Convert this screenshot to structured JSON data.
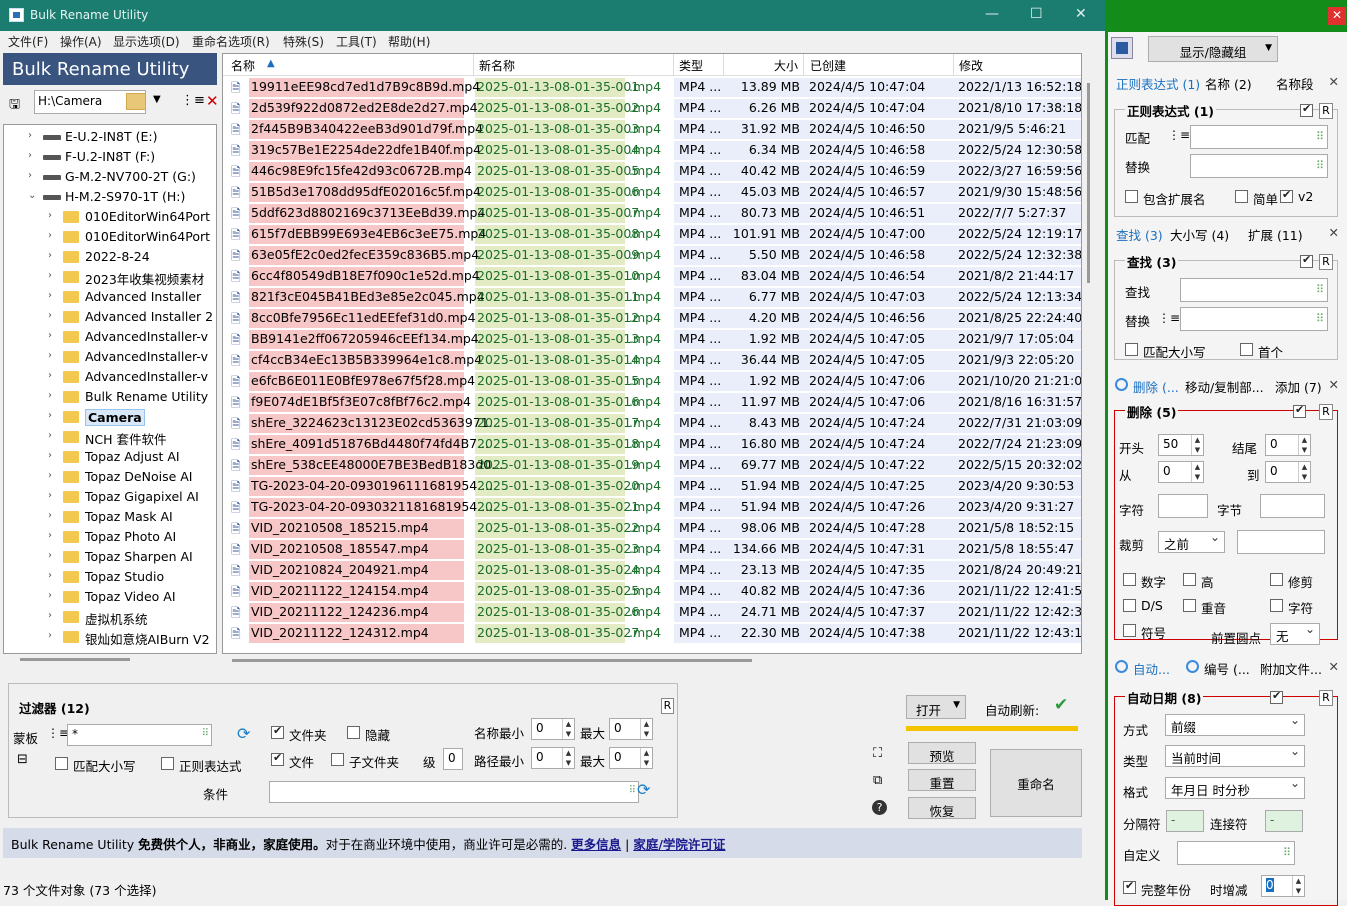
{
  "window": {
    "title": "Bulk Rename Utility"
  },
  "menu": [
    "文件(F)",
    "操作(A)",
    "显示选项(D)",
    "重命名选项(R)",
    "特殊(S)",
    "工具(T)",
    "帮助(H)"
  ],
  "brand": "Bulk Rename Utility",
  "path": "H:\\Camera",
  "tree": [
    {
      "label": "E-U.2-IN8T (E:)",
      "type": "drive",
      "level": 0
    },
    {
      "label": "F-U.2-IN8T (F:)",
      "type": "drive",
      "level": 0
    },
    {
      "label": "G-M.2-NV700-2T (G:)",
      "type": "drive",
      "level": 0
    },
    {
      "label": "H-M.2-S970-1T (H:)",
      "type": "drive",
      "level": 0,
      "open": true
    },
    {
      "label": "010EditorWin64Port",
      "type": "folder",
      "level": 1
    },
    {
      "label": "010EditorWin64Port",
      "type": "folder",
      "level": 1
    },
    {
      "label": "2022-8-24",
      "type": "folder",
      "level": 1
    },
    {
      "label": "2023年收集视频素材",
      "type": "folder",
      "level": 1
    },
    {
      "label": "Advanced Installer",
      "type": "folder",
      "level": 1
    },
    {
      "label": "Advanced Installer 2",
      "type": "folder",
      "level": 1
    },
    {
      "label": "AdvancedInstaller-v",
      "type": "folder",
      "level": 1
    },
    {
      "label": "AdvancedInstaller-v",
      "type": "folder",
      "level": 1
    },
    {
      "label": "AdvancedInstaller-v",
      "type": "folder",
      "level": 1
    },
    {
      "label": "Bulk Rename Utility",
      "type": "folder",
      "level": 1
    },
    {
      "label": "Camera",
      "type": "folder",
      "level": 1,
      "selected": true
    },
    {
      "label": "NCH 套件软件",
      "type": "folder",
      "level": 1
    },
    {
      "label": "Topaz Adjust AI",
      "type": "folder",
      "level": 1
    },
    {
      "label": "Topaz DeNoise AI",
      "type": "folder",
      "level": 1
    },
    {
      "label": "Topaz Gigapixel AI",
      "type": "folder",
      "level": 1
    },
    {
      "label": "Topaz Mask AI",
      "type": "folder",
      "level": 1
    },
    {
      "label": "Topaz Photo AI",
      "type": "folder",
      "level": 1
    },
    {
      "label": "Topaz Sharpen AI",
      "type": "folder",
      "level": 1
    },
    {
      "label": "Topaz Studio",
      "type": "folder",
      "level": 1
    },
    {
      "label": "Topaz Video AI",
      "type": "folder",
      "level": 1
    },
    {
      "label": "虚拟机系统",
      "type": "folder",
      "level": 1
    },
    {
      "label": "银灿如意烧AIBurn V2",
      "type": "folder",
      "level": 1
    }
  ],
  "columns": [
    "名称",
    "新名称",
    "类型",
    "大小",
    "已创建",
    "修改"
  ],
  "files": [
    [
      "19911eEE98cd7ed1d7B9c8B9d.mp4",
      "2025-01-13-08-01-35-001",
      ".mp4",
      "MP4 ...",
      "13.89 MB",
      "2024/4/5 10:47:04",
      "2022/1/13 16:52:18"
    ],
    [
      "2d539f922d0872ed2E8de2d27.mp4",
      "2025-01-13-08-01-35-002",
      ".mp4",
      "MP4 ...",
      "6.26 MB",
      "2024/4/5 10:47:04",
      "2021/8/10 17:38:18"
    ],
    [
      "2f445B9B340422eeB3d901d79f.mp4",
      "2025-01-13-08-01-35-003",
      ".mp4",
      "MP4 ...",
      "31.92 MB",
      "2024/4/5 10:46:50",
      "2021/9/5 5:46:21"
    ],
    [
      "319c57Be1E2254de22dfe1B40f.mp4",
      "2025-01-13-08-01-35-004",
      ".mp4",
      "MP4 ...",
      "6.34 MB",
      "2024/4/5 10:46:58",
      "2022/5/24 12:30:58"
    ],
    [
      "446c98E9fc15fe42d93c0672B.mp4",
      "2025-01-13-08-01-35-005",
      ".mp4",
      "MP4 ...",
      "40.42 MB",
      "2024/4/5 10:46:59",
      "2022/3/27 16:59:56"
    ],
    [
      "51B5d3e1708dd95dfE02016c5f.mp4",
      "2025-01-13-08-01-35-006",
      ".mp4",
      "MP4 ...",
      "45.03 MB",
      "2024/4/5 10:46:57",
      "2021/9/30 15:48:56"
    ],
    [
      "5ddf623d8802169c3713EeBd39.mp4",
      "2025-01-13-08-01-35-007",
      ".mp4",
      "MP4 ...",
      "80.73 MB",
      "2024/4/5 10:46:51",
      "2022/7/7 5:27:37"
    ],
    [
      "615f7dEBB99E693e4EB6c3eE75.mp4",
      "2025-01-13-08-01-35-008",
      ".mp4",
      "MP4 ...",
      "101.91 MB",
      "2024/4/5 10:47:00",
      "2022/5/24 12:19:17"
    ],
    [
      "63e05fE2c0ed2fecE359c836B5.mp4",
      "2025-01-13-08-01-35-009",
      ".mp4",
      "MP4 ...",
      "5.50 MB",
      "2024/4/5 10:46:58",
      "2022/5/24 12:32:38"
    ],
    [
      "6cc4f80549dB18E7f090c1e52d.mp4",
      "2025-01-13-08-01-35-010",
      ".mp4",
      "MP4 ...",
      "83.04 MB",
      "2024/4/5 10:46:54",
      "2021/8/2 21:44:17"
    ],
    [
      "821f3cE045B41BEd3e85e2c045.mp4",
      "2025-01-13-08-01-35-011",
      ".mp4",
      "MP4 ...",
      "6.77 MB",
      "2024/4/5 10:47:03",
      "2022/5/24 12:13:34"
    ],
    [
      "8cc0Bfe7956Ec11edEEfef31d0.mp4",
      "2025-01-13-08-01-35-012",
      ".mp4",
      "MP4 ...",
      "4.20 MB",
      "2024/4/5 10:46:56",
      "2021/8/25 22:24:40"
    ],
    [
      "BB9141e2ff067205946cEEf134.mp4",
      "2025-01-13-08-01-35-013",
      ".mp4",
      "MP4 ...",
      "1.92 MB",
      "2024/4/5 10:47:05",
      "2021/9/7 17:05:04"
    ],
    [
      "cf4ccB34eEc13B5B339964e1c8.mp4",
      "2025-01-13-08-01-35-014",
      ".mp4",
      "MP4 ...",
      "36.44 MB",
      "2024/4/5 10:47:05",
      "2021/9/3 22:05:20"
    ],
    [
      "e6fcB6E011E0BfE978e67f5f28.mp4",
      "2025-01-13-08-01-35-015",
      ".mp4",
      "MP4 ...",
      "1.92 MB",
      "2024/4/5 10:47:06",
      "2021/10/20 21:21:04"
    ],
    [
      "f9E074dE1Bf5f3E07c8fBf76c2.mp4",
      "2025-01-13-08-01-35-016",
      ".mp4",
      "MP4 ...",
      "11.97 MB",
      "2024/4/5 10:47:06",
      "2021/8/16 16:31:57"
    ],
    [
      "shEre_3224623c13123E02cd5363971...",
      "2025-01-13-08-01-35-017",
      ".mp4",
      "MP4 ...",
      "8.43 MB",
      "2024/4/5 10:47:24",
      "2022/7/31 21:03:09"
    ],
    [
      "shEre_4091d51876Bd4480f74fd4B7...",
      "2025-01-13-08-01-35-018",
      ".mp4",
      "MP4 ...",
      "16.80 MB",
      "2024/4/5 10:47:24",
      "2022/7/24 21:23:09"
    ],
    [
      "shEre_538cEE48000E7BE3BedB183d0...",
      "2025-01-13-08-01-35-019",
      ".mp4",
      "MP4 ...",
      "69.77 MB",
      "2024/4/5 10:47:22",
      "2022/5/15 20:32:02"
    ],
    [
      "TG-2023-04-20-0930196111681954....",
      "2025-01-13-08-01-35-020",
      ".mp4",
      "MP4 ...",
      "51.94 MB",
      "2024/4/5 10:47:25",
      "2023/4/20 9:30:53"
    ],
    [
      "TG-2023-04-20-0930321181681954....",
      "2025-01-13-08-01-35-021",
      ".mp4",
      "MP4 ...",
      "51.94 MB",
      "2024/4/5 10:47:26",
      "2023/4/20 9:31:27"
    ],
    [
      "VID_20210508_185215.mp4",
      "2025-01-13-08-01-35-022",
      ".mp4",
      "MP4 ...",
      "98.06 MB",
      "2024/4/5 10:47:28",
      "2021/5/8 18:52:15"
    ],
    [
      "VID_20210508_185547.mp4",
      "2025-01-13-08-01-35-023",
      ".mp4",
      "MP4 ...",
      "134.66 MB",
      "2024/4/5 10:47:31",
      "2021/5/8 18:55:47"
    ],
    [
      "VID_20210824_204921.mp4",
      "2025-01-13-08-01-35-024",
      ".mp4",
      "MP4 ...",
      "23.13 MB",
      "2024/4/5 10:47:35",
      "2021/8/24 20:49:21"
    ],
    [
      "VID_20211122_124154.mp4",
      "2025-01-13-08-01-35-025",
      ".mp4",
      "MP4 ...",
      "40.82 MB",
      "2024/4/5 10:47:36",
      "2021/11/22 12:41:54"
    ],
    [
      "VID_20211122_124236.mp4",
      "2025-01-13-08-01-35-026",
      ".mp4",
      "MP4 ...",
      "24.71 MB",
      "2024/4/5 10:47:37",
      "2021/11/22 12:42:36"
    ],
    [
      "VID_20211122_124312.mp4",
      "2025-01-13-08-01-35-027",
      ".mp4",
      "MP4 ...",
      "22.30 MB",
      "2024/4/5 10:47:38",
      "2021/11/22 12:43:12"
    ]
  ],
  "filter": {
    "title": "过滤器 (12)",
    "mask_label": "蒙板",
    "mask_value": "*",
    "match_case": "匹配大小写",
    "regex": "正则表达式",
    "folders": "文件夹",
    "hidden": "隐藏",
    "files": "文件",
    "subfolders": "子文件夹",
    "level_label": "级",
    "level": "0",
    "name_min": "名称最小",
    "name_min_v": "0",
    "max1": "最大",
    "max1_v": "0",
    "path_min": "路径最小",
    "path_min_v": "0",
    "max2": "最大",
    "max2_v": "0",
    "cond": "条件",
    "r": "R"
  },
  "actions": {
    "open": "打开",
    "autorefresh": "自动刷新:",
    "preview": "预览",
    "reset": "重置",
    "restore": "恢复",
    "rename": "重命名"
  },
  "info": {
    "text1": "Bulk Rename Utility ",
    "bold": "免费供个人，非商业，家庭使用。",
    "text2": "对于在商业环境中使用，商业许可是必需的.",
    "link1": "更多信息",
    "sep": "|",
    "link2": "家庭/学院许可证"
  },
  "status": "73 个文件对象  (73 个选择)",
  "right": {
    "group_btn": "显示/隐藏组",
    "tabs1": [
      "正则表达式 (1)",
      "名称 (2)",
      "名称段"
    ],
    "regex": {
      "title": "正则表达式 (1)",
      "match": "匹配",
      "replace": "替换",
      "incl_ext": "包含扩展名",
      "simple": "简单",
      "v2": "v2",
      "r": "R"
    },
    "tabs2": [
      "查找 (3)",
      "大小写 (4)",
      "扩展 (11)"
    ],
    "find": {
      "title": "查找 (3)",
      "find": "查找",
      "replace": "替换",
      "match_case": "匹配大小写",
      "first": "首个",
      "r": "R"
    },
    "tabs3": [
      "删除 (...",
      "移动/复制部...",
      "添加 (7)"
    ],
    "del": {
      "title": "删除 (5)",
      "first": "开头",
      "first_v": "50",
      "last": "结尾",
      "last_v": "0",
      "from": "从",
      "from_v": "0",
      "to": "到",
      "to_v": "0",
      "chars": "字符",
      "words": "字节",
      "crop": "裁剪",
      "crop_v": "之前",
      "digits": "数字",
      "high": "高",
      "trim": "修剪",
      "ds": "D/S",
      "accent": "重音",
      "chars2": "字符",
      "sym": "符号",
      "lead": "前置圆点",
      "lead_v": "无",
      "r": "R"
    },
    "tabs4": [
      "自动...",
      "编号 (...",
      "附加文件..."
    ],
    "autodate": {
      "title": "自动日期 (8)",
      "mode": "方式",
      "mode_v": "前缀",
      "type": "类型",
      "type_v": "当前时间",
      "fmt": "格式",
      "fmt_v": "年月日 时分秒",
      "sep": "分隔符",
      "sep_v": "-",
      "join": "连接符",
      "join_v": "-",
      "custom": "自定义",
      "fullyear": "完整年份",
      "offset": "时增减",
      "offset_v": "0",
      "r": "R"
    }
  }
}
